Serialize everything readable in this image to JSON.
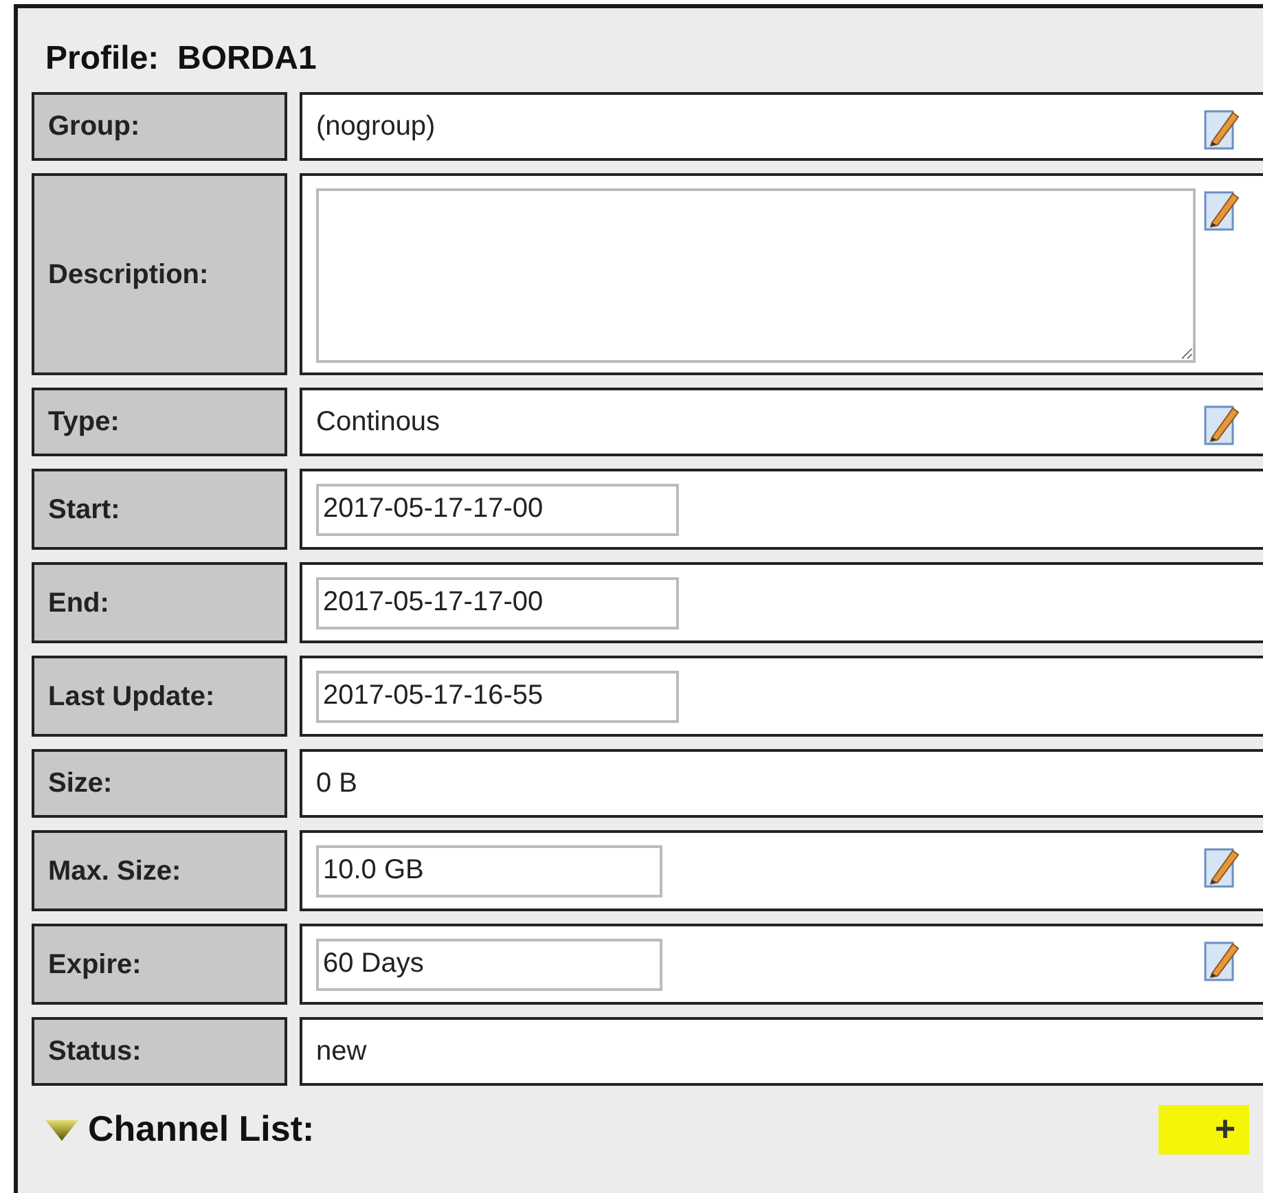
{
  "title": "Profile:  BORDA1",
  "fields": [
    {
      "label": "Group:",
      "kind": "text",
      "value": "(nogroup)",
      "editable": true
    },
    {
      "label": "Description:",
      "kind": "textarea",
      "editable": true
    },
    {
      "label": "Type:",
      "kind": "text",
      "value": "Continous",
      "editable": true
    },
    {
      "label": "Start:",
      "kind": "input",
      "value": "2017-05-17-17-00",
      "editable": false
    },
    {
      "label": "End:",
      "kind": "input",
      "value": "2017-05-17-17-00",
      "editable": false
    },
    {
      "label": "Last Update:",
      "kind": "input",
      "value": "2017-05-17-16-55",
      "editable": false
    },
    {
      "label": "Size:",
      "kind": "text",
      "value": "0 B",
      "editable": false
    },
    {
      "label": "Max. Size:",
      "kind": "input_short",
      "value": "10.0 GB",
      "editable": true
    },
    {
      "label": "Expire:",
      "kind": "input_short",
      "value": "60 Days",
      "editable": true
    },
    {
      "label": "Status:",
      "kind": "text",
      "value": "new",
      "editable": false
    }
  ],
  "section": {
    "title": "Channel List:",
    "expanded": true,
    "add_button": "+"
  }
}
